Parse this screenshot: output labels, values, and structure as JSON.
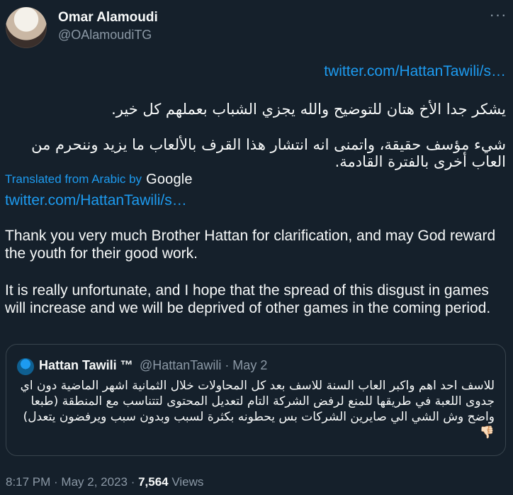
{
  "author": {
    "name": "Omar Alamoudi",
    "handle": "@OAlamoudiTG",
    "avatar_icon": "avatar-icon"
  },
  "menu": {
    "more_label": "···"
  },
  "links": {
    "top": "twitter.com/HattanTawili/s…",
    "bottom": "twitter.com/HattanTawili/s…"
  },
  "arabic_text": {
    "paragraph_1": "يشكر جدا الأخ هتان للتوضيح والله يجزي الشباب بعملهم كل خير.",
    "paragraph_2": "شيء مؤسف حقيقة، واتمنى انه انتشار هذا القرف بالألعاب ما يزيد وننحرم من العاب أخرى بالفترة القادمة."
  },
  "translation": {
    "label": "Translated from Arabic by",
    "provider": "Google"
  },
  "english_text": {
    "paragraph_1": "Thank you very much Brother Hattan for clarification, and may God reward the youth for their good work.",
    "paragraph_2": "It is really unfortunate, and I hope that the spread of this disgust in games will increase and we will be deprived of other games in the coming period."
  },
  "quote": {
    "name": "Hattan Tawili ™",
    "handle_date": "@HattanTawili · May 2",
    "text": "للاسف احد اهم واكبر العاب السنة للاسف بعد كل المحاولات خلال الثمانية اشهر الماضية دون اي جدوى اللعبة في طريقها للمنع لرفض الشركة التام لتعديل المحتوى لتتناسب مع المنطقة (طبعا واضح وش الشي الي صايرين الشركات بس يحطونه بكثرة لسبب وبدون سبب ويرفضون يتعدل) 👎🏻"
  },
  "footer": {
    "time_date": "8:17 PM · May 2, 2023 · ",
    "views_count": "7,564",
    "views_label": " Views"
  },
  "colors": {
    "background": "#15202b",
    "text_primary": "#f7f9f9",
    "text_secondary": "#8b98a5",
    "link": "#1d9bf0",
    "border": "#38444d"
  }
}
